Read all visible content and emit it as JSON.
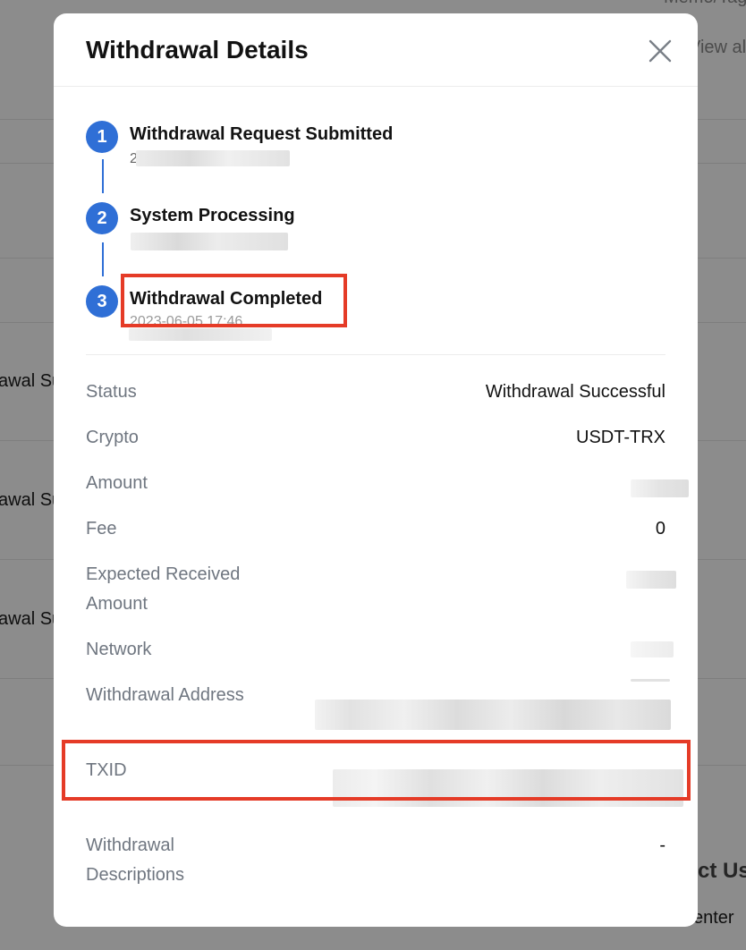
{
  "background": {
    "top_right_text": "Memo/Tag",
    "view_all_text": "View all d",
    "row_label": "awal Su",
    "contact_text": "ct Us",
    "center_text": "enter"
  },
  "modal": {
    "title": "Withdrawal Details",
    "steps": [
      {
        "number": "1",
        "label": "Withdrawal Request Submitted",
        "time": "2"
      },
      {
        "number": "2",
        "label": "System Processing",
        "time": ""
      },
      {
        "number": "3",
        "label": "Withdrawal Completed",
        "time": "2023-06-05 17:46"
      }
    ],
    "details": {
      "status_label": "Status",
      "status_value": "Withdrawal Successful",
      "crypto_label": "Crypto",
      "crypto_value": "USDT-TRX",
      "amount_label": "Amount",
      "fee_label": "Fee",
      "fee_value": "0",
      "expected_label_line1": "Expected Received",
      "expected_label_line2": "Amount",
      "network_label": "Network",
      "address_label": "Withdrawal Address",
      "txid_label": "TXID",
      "descriptions_label_line1": "Withdrawal",
      "descriptions_label_line2": "Descriptions",
      "descriptions_value": "-"
    }
  },
  "colors": {
    "accent": "#2f6fd6",
    "highlight": "#e53b27"
  },
  "icons": {
    "close": "close-icon"
  }
}
